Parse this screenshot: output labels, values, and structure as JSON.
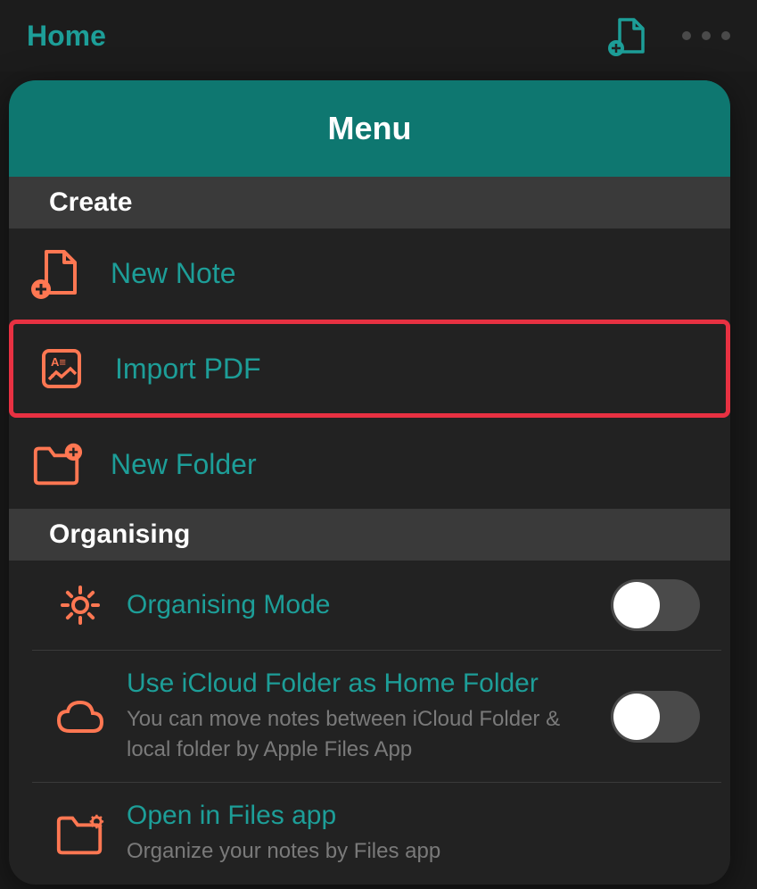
{
  "topBar": {
    "homeLabel": "Home"
  },
  "menu": {
    "title": "Menu",
    "sections": {
      "create": {
        "title": "Create",
        "items": {
          "newNote": "New Note",
          "importPdf": "Import PDF",
          "newFolder": "New Folder"
        }
      },
      "organising": {
        "title": "Organising",
        "items": {
          "organisingMode": {
            "label": "Organising Mode"
          },
          "icloudFolder": {
            "title": "Use iCloud Folder as Home Folder",
            "subtitle": "You can move notes between iCloud Folder & local folder by Apple Files App"
          },
          "filesApp": {
            "title": "Open in Files app",
            "subtitle": "Organize your notes by Files app"
          }
        }
      }
    }
  },
  "colors": {
    "accent": "#1d9e98",
    "iconOrange": "#ff7752",
    "highlight": "#e83142",
    "menuHeader": "#0e7770"
  }
}
